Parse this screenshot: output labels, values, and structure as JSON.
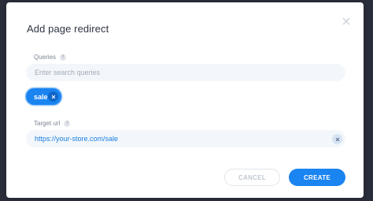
{
  "dialog": {
    "title": "Add page redirect",
    "close_icon": "close-icon"
  },
  "queries": {
    "label": "Queries",
    "help": "?",
    "placeholder": "Enter search queries",
    "chips": [
      {
        "label": "sale",
        "remove_icon": "close-icon"
      }
    ]
  },
  "target": {
    "label": "Target url",
    "help": "?",
    "value": "https://your-store.com/sale",
    "clear_icon": "close-icon"
  },
  "actions": {
    "cancel_label": "CANCEL",
    "create_label": "CREATE"
  },
  "colors": {
    "accent": "#1a84f0",
    "input_bg": "#f3f7fb",
    "overlay": "#2a2e3a"
  }
}
